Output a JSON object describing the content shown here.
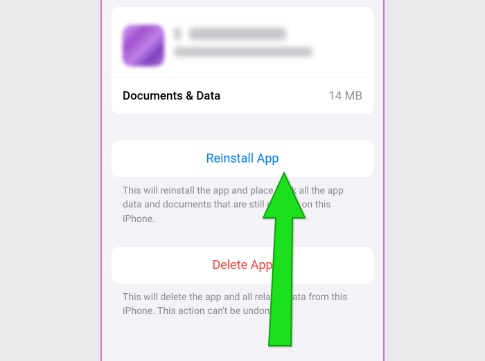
{
  "storage": {
    "documents_label": "Documents & Data",
    "documents_size": "14 MB"
  },
  "actions": {
    "reinstall": {
      "label": "Reinstall App",
      "description": "This will reinstall the app and place back all the app data and documents that are still present on this iPhone."
    },
    "delete": {
      "label": "Delete App",
      "description": "This will delete the app and all related data from this iPhone. This action can't be undone."
    }
  }
}
